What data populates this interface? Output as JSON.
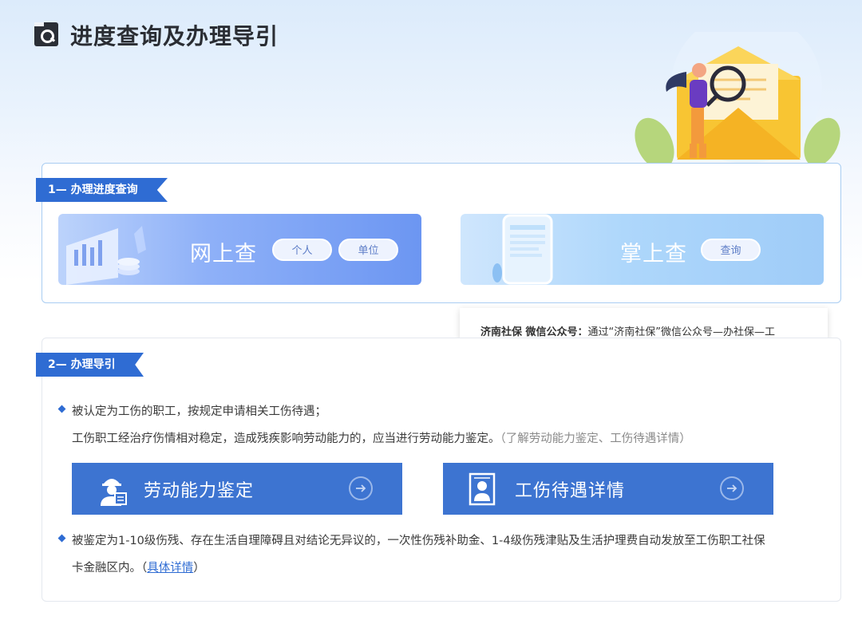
{
  "header": {
    "title": "进度查询及办理导引"
  },
  "section1": {
    "ribbon": "1— 办理进度查询",
    "online": {
      "title": "网上查",
      "btn_personal": "个人",
      "btn_unit": "单位"
    },
    "mobile": {
      "title": "掌上查",
      "btn_query": "查询"
    }
  },
  "popup": {
    "label": "济南社保 微信公众号：",
    "text": "通过“济南社保”微信公众号—办社保—工"
  },
  "section2": {
    "ribbon": "2— 办理导引",
    "para1_line1": "被认定为工伤的职工，按规定申请相关工伤待遇；",
    "para1_line2": "工伤职工经治疗伤情相对稳定，造成残疾影响劳动能力的，应当进行劳动能力鉴定。",
    "para1_note": "（了解劳动能力鉴定、工伤待遇详情）",
    "btn_ability": "劳动能力鉴定",
    "btn_benefit": "工伤待遇详情",
    "para2_line1": "被鉴定为1-10级伤残、存在生活自理障碍且对结论无异议的，一次性伤残补助金、1-4级伤残津贴及生活护理费自动发放至工伤职工社保",
    "para2_line2_pre": "卡金融区内。（",
    "para2_link": "具体详情",
    "para2_line2_post": "）"
  },
  "colors": {
    "accent": "#2f6cd3",
    "button": "#3d74d1",
    "card_border": "#a9cdf2"
  }
}
